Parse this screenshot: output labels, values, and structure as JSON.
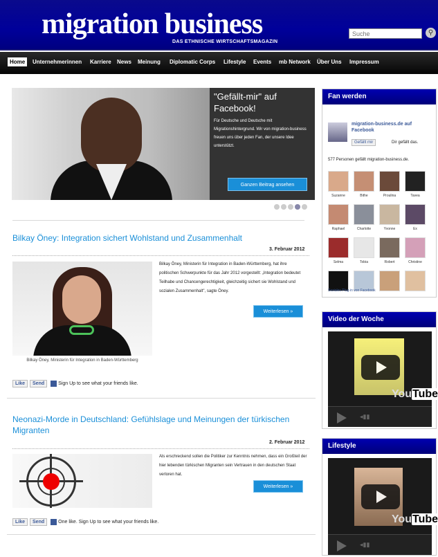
{
  "header": {
    "logo": "migration business",
    "tagline": "DAS ETHNISCHE WIRTSCHAFTSMAGAZIN",
    "search_placeholder": "Suche"
  },
  "nav": [
    "Home",
    "Unternehmerinnen",
    "Karriere",
    "News",
    "Meinung",
    "Diplomatic Corps",
    "Lifestyle",
    "Events",
    "mb Network",
    "Über Uns",
    "Impressum"
  ],
  "hero": {
    "title": "\"Gefällt-mir\" auf Facebook!",
    "text": "Für Deutsche und Deutsche mit Migrationshintergrund. Wir von migration-business freuen uns über jeden Fan, der unsere Idee unterstützt.",
    "button": "Ganzen Beitrag ansehen"
  },
  "posts": [
    {
      "title": "Bilkay Öney: Integration sichert Wohlstand und Zusammenhalt",
      "date": "3. Februar 2012",
      "caption": "Bilkay Öney, Ministerin für Integration in Baden-Württemberg",
      "excerpt": "Bilkay Öney, Ministerin für Integration in Baden-Württemberg, hat ihre politischen Schwerpunkte für das Jahr 2012 vorgestellt: „Integration bedeutet Teilhabe und Chancengerechtigkeit, gleichzeitig sichert sie Wohlstand und sozialen Zusammenhalt\", sagte Öney.",
      "more": "Weiterlesen »",
      "share": {
        "like": "Like",
        "send": "Send",
        "text": "Sign Up to see what your friends like.",
        "link": "Sign Up"
      }
    },
    {
      "title": "Neonazi-Morde in Deutschland: Gefühlslage und Meinungen der türkischen Migranten",
      "date": "2. Februar 2012",
      "excerpt": "Als erschreckend sollen die Politiker zur Kenntnis nehmen, dass ein Großteil der hier lebenden türkischen Migranten sein Vertrauen in den deutschen Staat verloren hat.",
      "more": "Weiterlesen »",
      "share": {
        "like": "Like",
        "send": "Send",
        "text": "One like. Sign Up to see what your friends like.",
        "link": "Sign Up"
      }
    }
  ],
  "sidebar": {
    "fan": {
      "heading": "Fan werden",
      "page_name": "migration-business.de auf Facebook",
      "like_button": "Gefällt mir",
      "likes_text": "Dir gefällt das.",
      "count_text": "577 Personen gefällt migration-business.de.",
      "people": [
        "Suzanne",
        "Bithe",
        "Proulina",
        "Tavea",
        "Raphael",
        "Charlotte",
        "Yvonne",
        "Ex",
        "Selma",
        "Tobia",
        "Robert",
        "Christine",
        "",
        "",
        "",
        ""
      ],
      "plugin": "Soziales Plug-in von Facebook"
    },
    "video": {
      "heading": "Video der Woche"
    },
    "lifestyle": {
      "heading": "Lifestyle"
    }
  },
  "icons": {
    "search": "magnifier-icon",
    "facebook": "facebook-icon",
    "play": "play-icon",
    "volume": "volume-icon"
  }
}
